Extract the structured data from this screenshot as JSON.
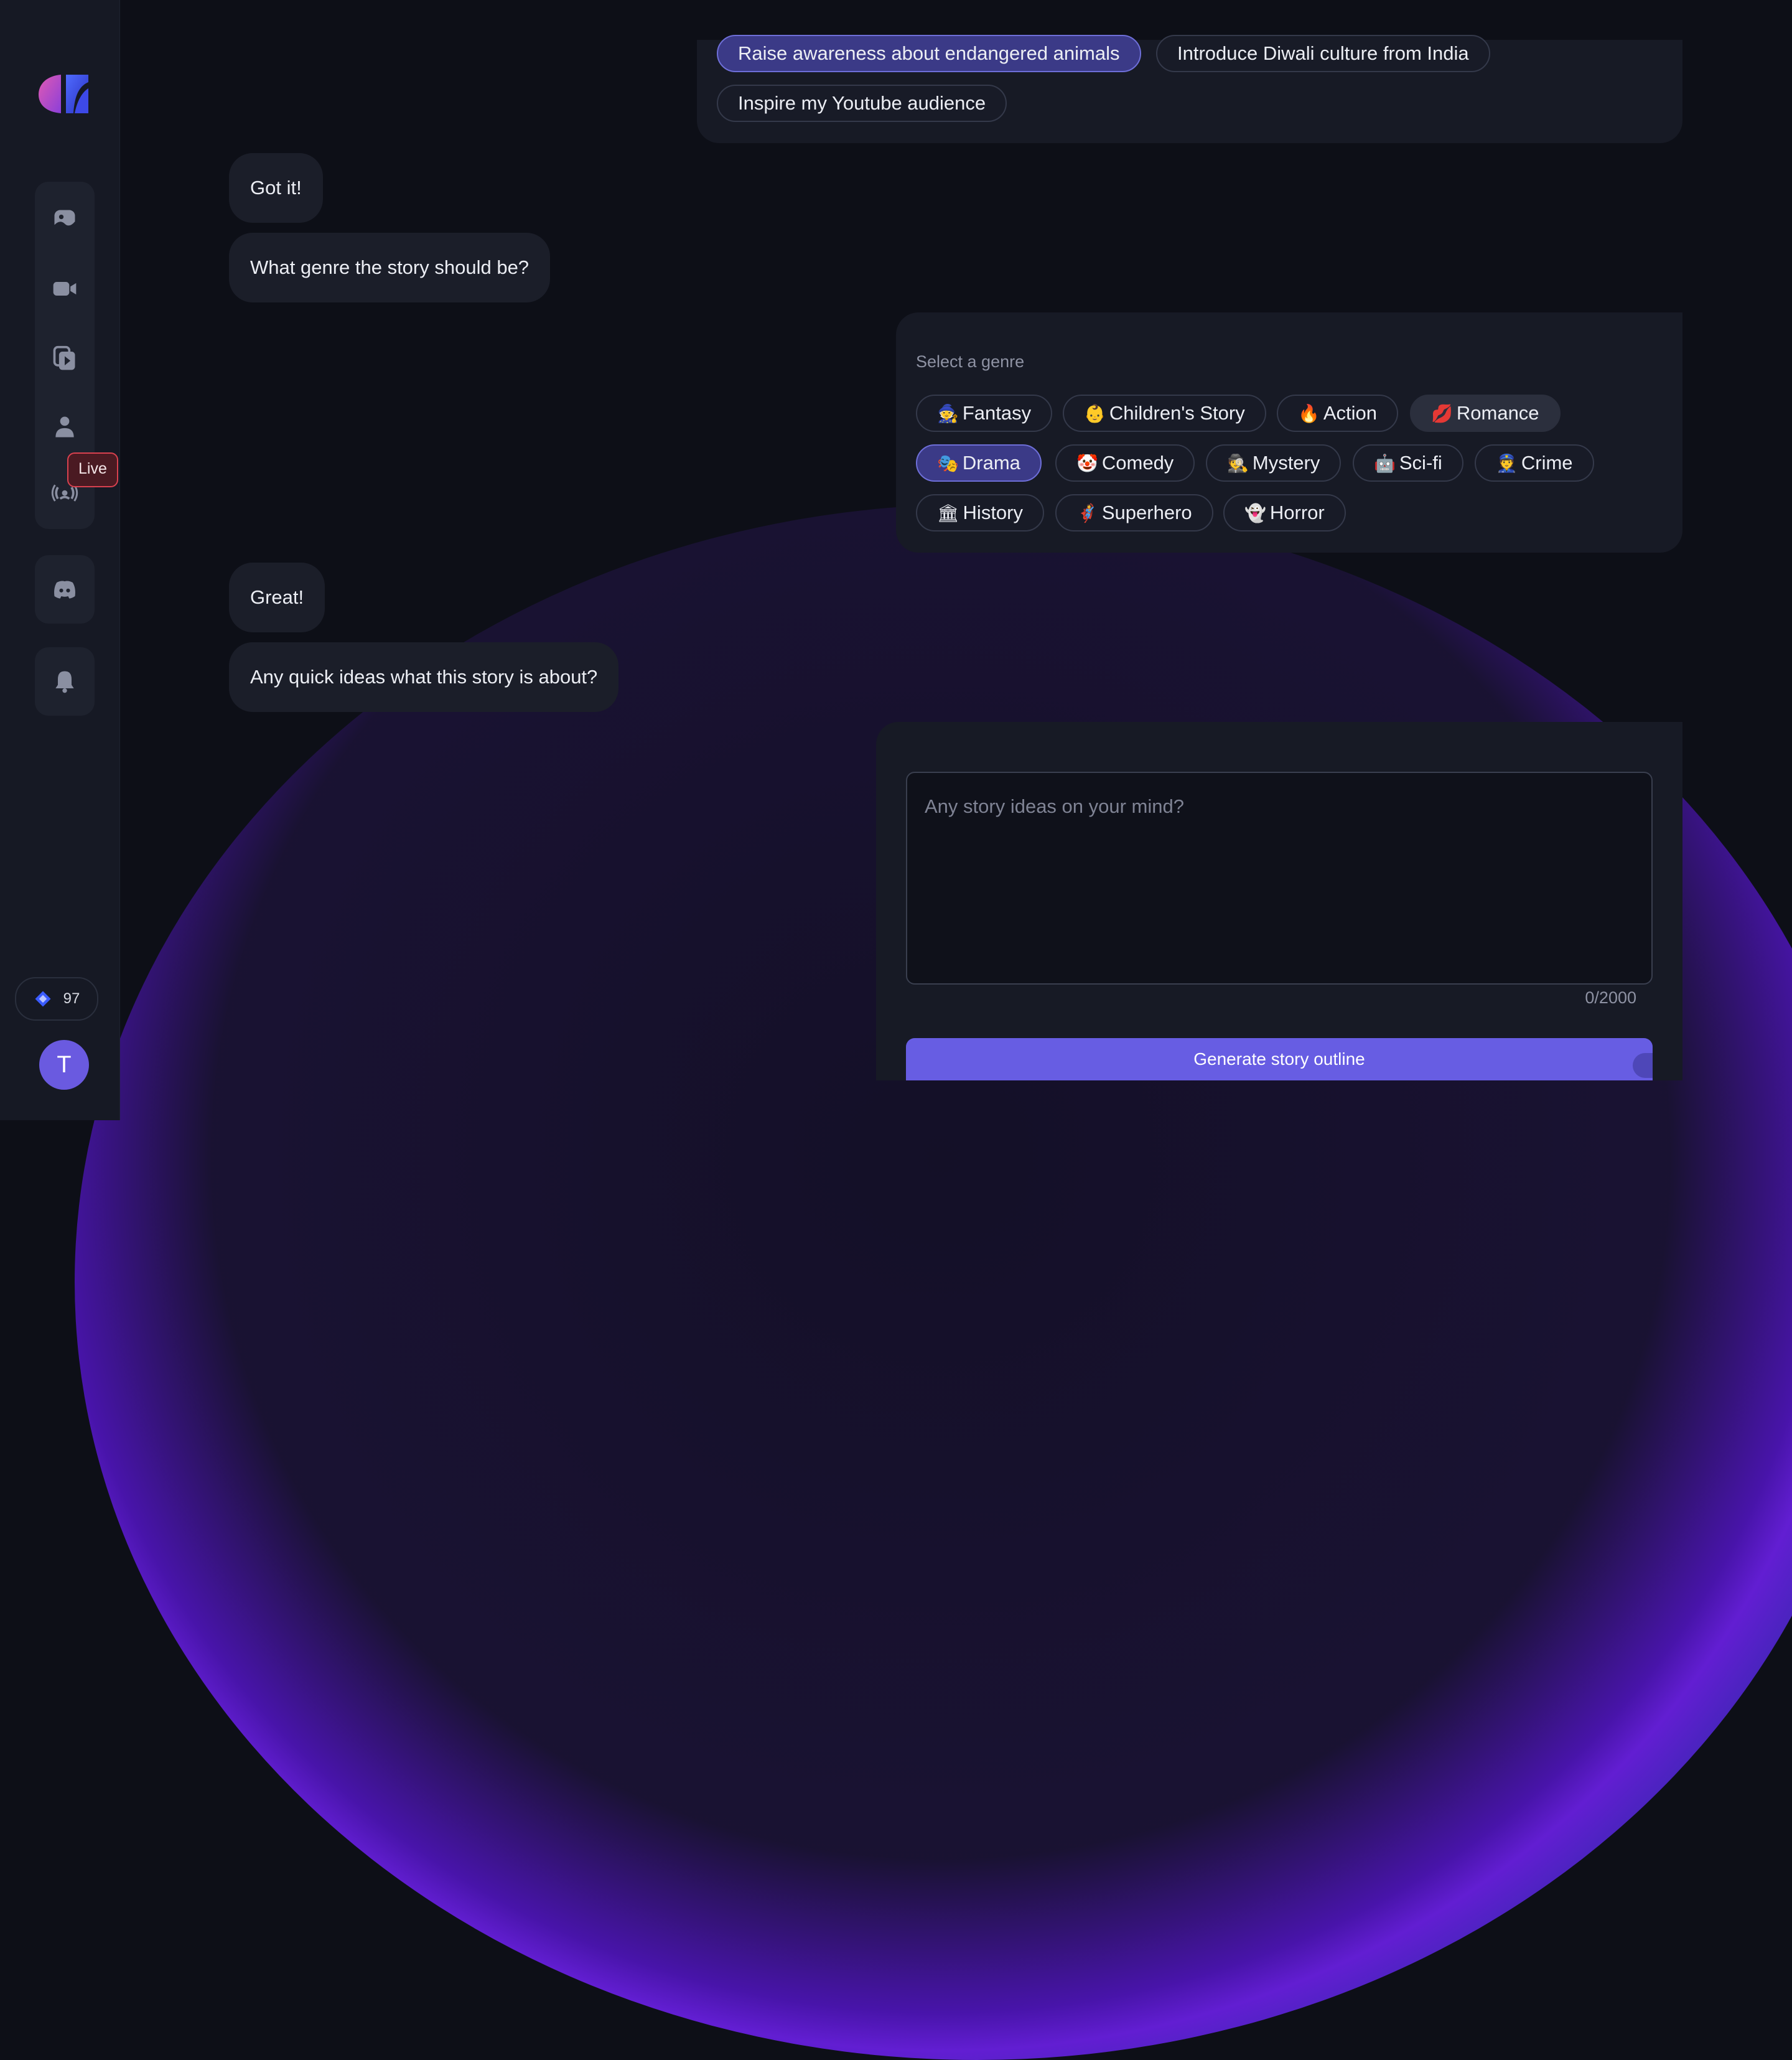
{
  "sidebar": {
    "nav_items": [
      "image-icon",
      "video-icon",
      "video-library-icon",
      "person-icon",
      "live-broadcast-icon"
    ],
    "live_badge": "Live",
    "credits": "97",
    "avatar_letter": "T"
  },
  "goal_options": [
    {
      "label": "Raise awareness about endangered animals",
      "selected": true
    },
    {
      "label": "Introduce Diwali culture from India",
      "selected": false
    },
    {
      "label": "Inspire my Youtube audience",
      "selected": false
    }
  ],
  "messages": {
    "m1": "Got it!",
    "m2": "What genre the story should be?",
    "m3": "Great!",
    "m4": "Any quick ideas what this story is about?"
  },
  "genre": {
    "label": "Select a genre",
    "options": [
      {
        "emoji": "🧙",
        "label": "Fantasy"
      },
      {
        "emoji": "👶",
        "label": "Children's Story"
      },
      {
        "emoji": "🔥",
        "label": "Action"
      },
      {
        "emoji": "💋",
        "label": "Romance"
      },
      {
        "emoji": "🎭",
        "label": "Drama",
        "selected": true
      },
      {
        "emoji": "🤡",
        "label": "Comedy"
      },
      {
        "emoji": "🕵",
        "label": "Mystery"
      },
      {
        "emoji": "🤖",
        "label": "Sci-fi"
      },
      {
        "emoji": "👮",
        "label": "Crime"
      },
      {
        "emoji": "🏛",
        "label": "History"
      },
      {
        "emoji": "🦸",
        "label": "Superhero"
      },
      {
        "emoji": "👻",
        "label": "Horror"
      }
    ]
  },
  "story_input": {
    "placeholder": "Any story ideas on your mind?",
    "counter": "0/2000",
    "button_label": "Generate story outline"
  },
  "colors": {
    "accent": "#675de3",
    "live": "#d9414f",
    "background": "#0d0f17"
  }
}
